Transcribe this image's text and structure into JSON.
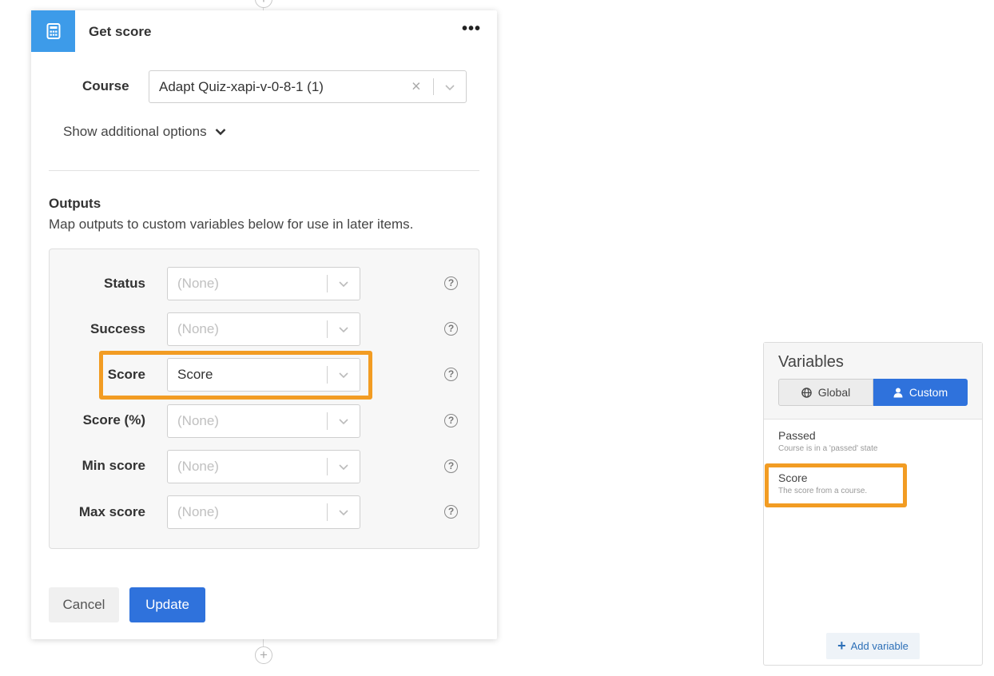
{
  "card": {
    "title": "Get score",
    "icon": "calculator-icon",
    "menu_icon": "more-horizontal-icon",
    "menu_label": "•••",
    "course": {
      "label": "Course",
      "value": "Adapt Quiz-xapi-v-0-8-1 (1)",
      "clear_label": "×"
    },
    "show_more_label": "Show additional options",
    "outputs": {
      "title": "Outputs",
      "description": "Map outputs to custom variables below for use in later items.",
      "rows": [
        {
          "label": "Status",
          "value": "(None)",
          "is_placeholder": true,
          "help": "?"
        },
        {
          "label": "Success",
          "value": "(None)",
          "is_placeholder": true,
          "help": "?"
        },
        {
          "label": "Score",
          "value": "Score",
          "is_placeholder": false,
          "help": "?"
        },
        {
          "label": "Score (%)",
          "value": "(None)",
          "is_placeholder": true,
          "help": "?"
        },
        {
          "label": "Min score",
          "value": "(None)",
          "is_placeholder": true,
          "help": "?"
        },
        {
          "label": "Max score",
          "value": "(None)",
          "is_placeholder": true,
          "help": "?"
        }
      ]
    },
    "cancel_label": "Cancel",
    "update_label": "Update"
  },
  "connectors": {
    "add_label": "+"
  },
  "variables": {
    "title": "Variables",
    "tabs": {
      "global": "Global",
      "custom": "Custom",
      "active": "custom"
    },
    "items": [
      {
        "name": "Passed",
        "description": "Course is in a 'passed' state"
      },
      {
        "name": "Score",
        "description": "The score from a course."
      }
    ],
    "add_label": "Add variable",
    "add_icon": "plus-icon"
  },
  "colors": {
    "primary": "#2f72dc",
    "header_icon_bg": "#3d9be9",
    "highlight": "#f29c23"
  }
}
